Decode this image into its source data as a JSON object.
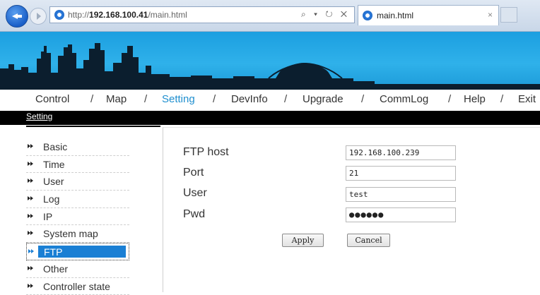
{
  "browser": {
    "url_prefix": "http://",
    "url_host": "192.168.100.41",
    "url_path": "/main.html",
    "address_tools": "⌕ ▾ ↻ ✕",
    "tab_title": "main.html",
    "tab_close": "×"
  },
  "menu": {
    "items": [
      "Control",
      "Map",
      "Setting",
      "DevInfo",
      "Upgrade",
      "CommLog",
      "Help",
      "Exit"
    ],
    "active": "Setting",
    "separator": "/"
  },
  "section": {
    "title": "Setting"
  },
  "sidebar": {
    "items": [
      "Basic",
      "Time",
      "User",
      "Log",
      "IP",
      "System map",
      "FTP",
      "Other",
      "Controller state"
    ],
    "active": "FTP"
  },
  "form": {
    "ftp_host_label": "FTP host",
    "ftp_host_value": "192.168.100.239",
    "port_label": "Port",
    "port_value": "21",
    "user_label": "User",
    "user_value": "test",
    "pwd_label": "Pwd",
    "pwd_value": "●●●●●●",
    "apply_label": "Apply",
    "cancel_label": "Cancel"
  },
  "colors": {
    "banner": "#2fb1ea",
    "active_menu": "#1f8fcf",
    "selection": "#1a7fd4"
  }
}
